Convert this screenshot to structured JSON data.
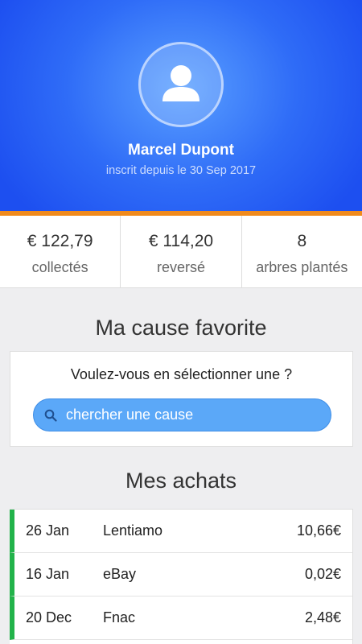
{
  "profile": {
    "name": "Marcel Dupont",
    "since": "inscrit depuis le 30 Sep 2017",
    "avatar_icon": "user-icon"
  },
  "colors": {
    "hero": "#2f6cf7",
    "accent_bar": "#f08a1c",
    "search": "#5ba8f8",
    "purchase_marker": "#22b34a"
  },
  "stats": [
    {
      "value": "€ 122,79",
      "label": "collectés"
    },
    {
      "value": "€ 114,20",
      "label": "reversé"
    },
    {
      "value": "8",
      "label": "arbres plantés"
    }
  ],
  "cause": {
    "title": "Ma cause favorite",
    "question": "Voulez-vous en sélectionner une ?",
    "search_placeholder": "chercher une cause",
    "search_icon": "search-icon"
  },
  "purchases": {
    "title": "Mes achats",
    "rows": [
      {
        "date": "26 Jan",
        "merchant": "Lentiamo",
        "amount": "10,66€"
      },
      {
        "date": "16 Jan",
        "merchant": "eBay",
        "amount": "0,02€"
      },
      {
        "date": "20 Dec",
        "merchant": "Fnac",
        "amount": "2,48€"
      }
    ]
  }
}
